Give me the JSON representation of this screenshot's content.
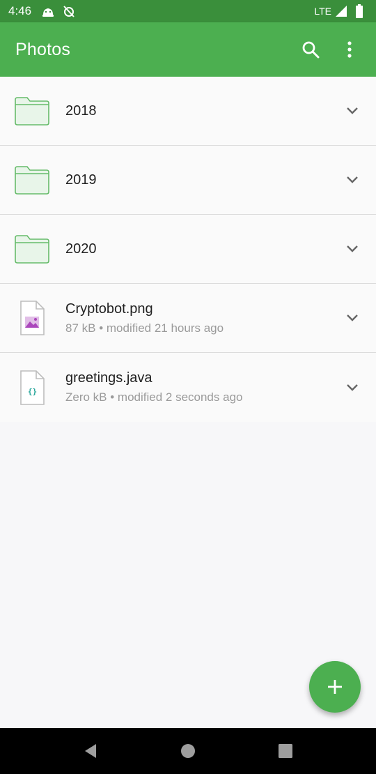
{
  "status_bar": {
    "time": "4:46",
    "network": "LTE"
  },
  "app_bar": {
    "title": "Photos"
  },
  "items": [
    {
      "name": "2018",
      "type": "folder",
      "meta": ""
    },
    {
      "name": "2019",
      "type": "folder",
      "meta": ""
    },
    {
      "name": "2020",
      "type": "folder",
      "meta": ""
    },
    {
      "name": "Cryptobot.png",
      "type": "image",
      "meta": "87 kB • modified 21 hours ago"
    },
    {
      "name": "greetings.java",
      "type": "code",
      "meta": "Zero kB • modified 2 seconds ago"
    }
  ],
  "colors": {
    "primary": "#4caf50",
    "primary_dark": "#3a8f3b",
    "folder_fill": "#e8f5e9",
    "folder_stroke": "#66bb6a"
  },
  "icons": {
    "status": [
      "android-debug-icon",
      "alarm-off-icon",
      "signal-icon",
      "battery-icon"
    ],
    "app_bar": [
      "search-icon",
      "overflow-menu-icon"
    ],
    "fab": "add-icon",
    "nav": [
      "back-icon",
      "home-icon",
      "recents-icon"
    ]
  }
}
